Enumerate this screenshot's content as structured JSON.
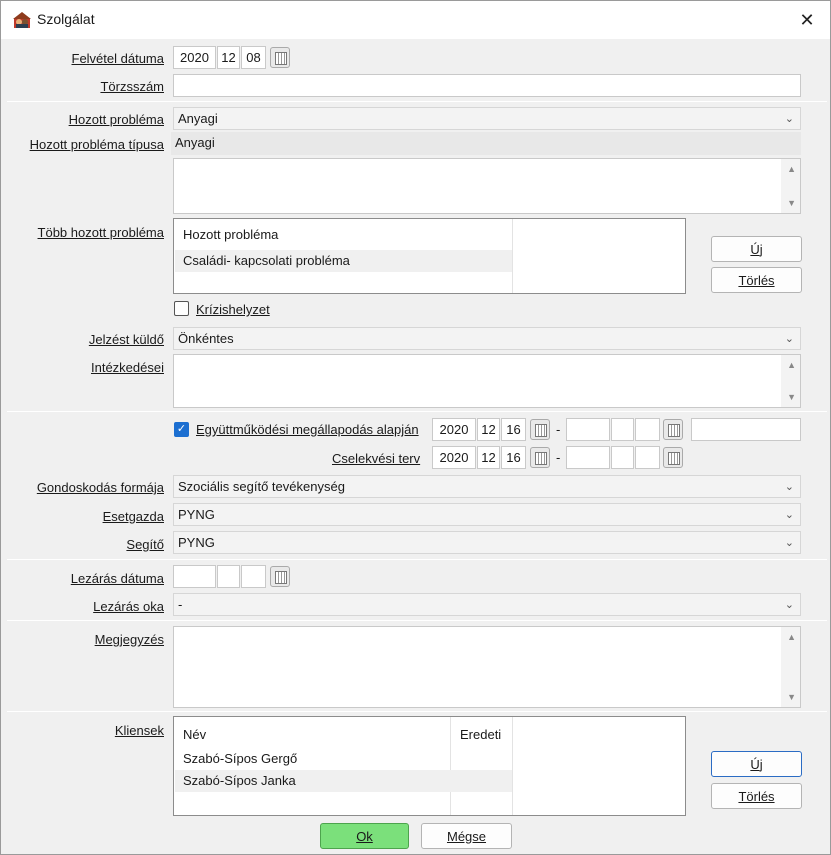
{
  "window": {
    "title": "Szolgálat",
    "close": "✕"
  },
  "labels": {
    "felvetel_datuma": "Felvétel dátuma",
    "torzsszam": "Törzsszám",
    "hozott_problema": "Hozott probléma",
    "hozott_problema_tipusa": "Hozott probléma típusa",
    "tobb_hozott_problema": "Több hozott probléma",
    "krizishelyzet": "Krízishelyzet",
    "jelzest_kuldo": "Jelzést küldő",
    "intezkedesei": "Intézkedései",
    "egyuttmukodesi": "Együttműködési megállapodás alapján",
    "cselekvesi_terv": "Cselekvési terv",
    "gondoskodas_formaja": "Gondoskodás formája",
    "esetgazda": "Esetgazda",
    "segito": "Segítő",
    "lezaras_datuma": "Lezárás dátuma",
    "lezaras_oka": "Lezárás oka",
    "megjegyzes": "Megjegyzés",
    "kliensek": "Kliensek"
  },
  "felvetel": {
    "year": "2020",
    "month": "12",
    "day": "08"
  },
  "torzsszam_value": "",
  "hozott_problema_value": "Anyagi",
  "hozott_problema_tipusa_value": "Anyagi",
  "problems_grid": {
    "header": "Hozott probléma",
    "rows": [
      "Családi- kapcsolati probléma"
    ]
  },
  "buttons": {
    "uj": "Új",
    "torles": "Törlés",
    "ok": "Ok",
    "megse": "Mégse"
  },
  "krizishelyzet_checked": false,
  "jelzest_kuldo_value": "Önkéntes",
  "egyuttmukodes": {
    "checked": true,
    "year": "2020",
    "month": "12",
    "day": "16",
    "dash": "-"
  },
  "cselekvesi": {
    "year": "2020",
    "month": "12",
    "day": "16",
    "dash": "-"
  },
  "gondoskodas_value": "Szociális segítő tevékenység",
  "esetgazda_value": "PYNG",
  "segito_value": "PYNG",
  "lezaras_oka_value": "-",
  "clients_grid": {
    "headers": [
      "Név",
      "Eredeti"
    ],
    "rows": [
      "Szabó-Sípos Gergő",
      "Szabó-Sípos Janka"
    ]
  },
  "colors": {
    "ok_button": "#7be07b",
    "checkbox": "#1c6fd1"
  }
}
